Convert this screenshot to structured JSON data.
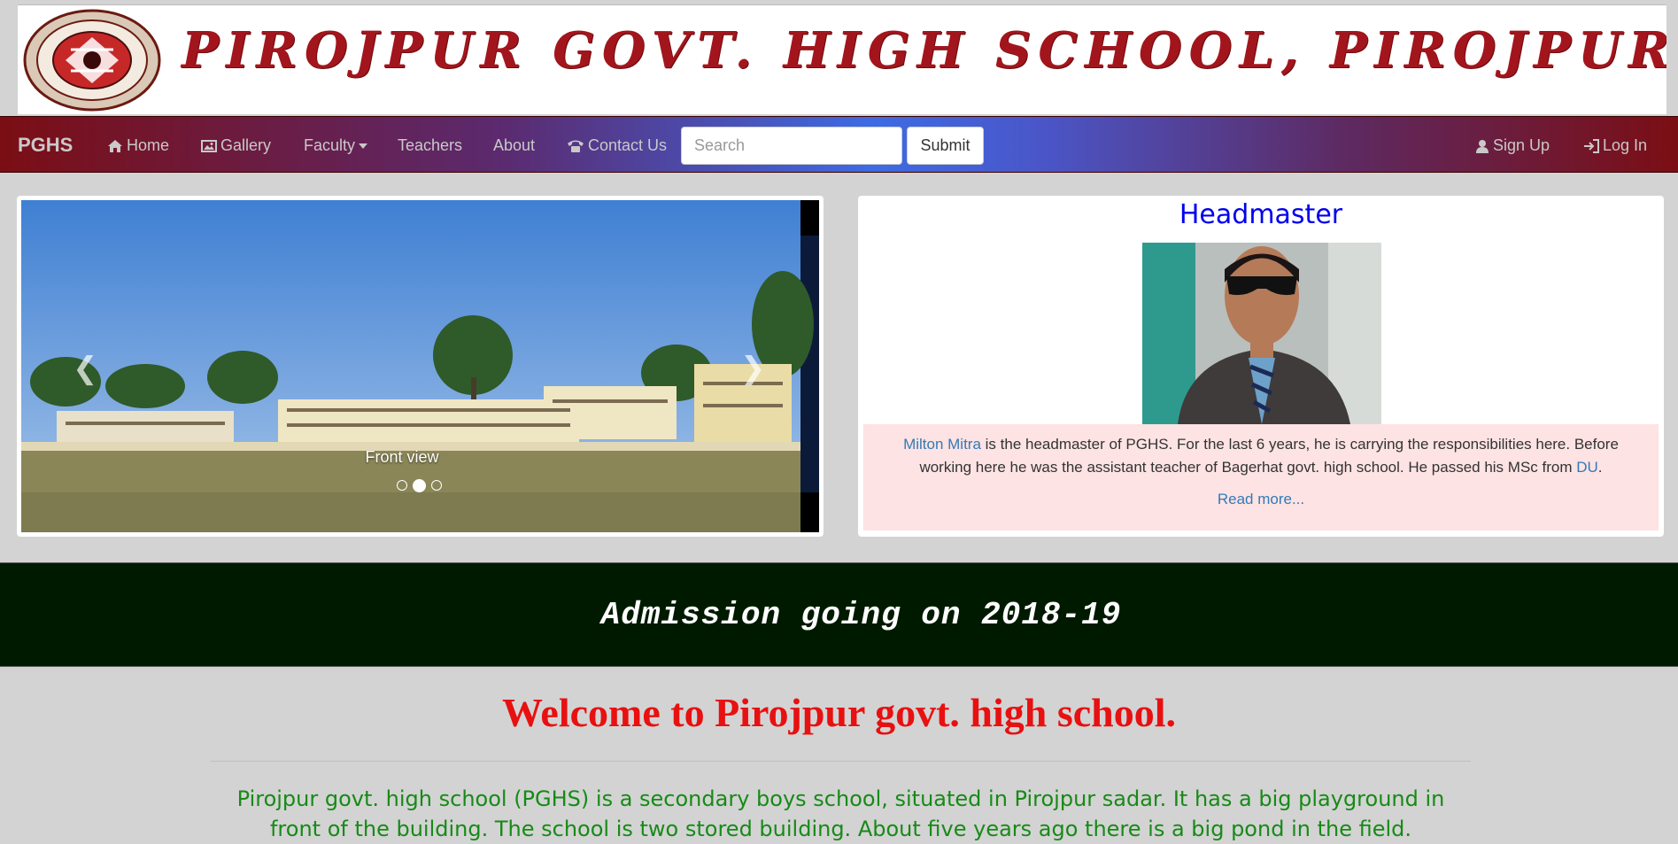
{
  "banner": {
    "title": "PIROJPUR GOVT. HIGH SCHOOL, PIROJPUR."
  },
  "navbar": {
    "brand": "PGHS",
    "items": [
      {
        "label": "Home",
        "icon": "home-icon"
      },
      {
        "label": "Gallery",
        "icon": "picture-icon"
      },
      {
        "label": "Faculty",
        "icon": "caret-down-icon"
      },
      {
        "label": "Teachers"
      },
      {
        "label": "About"
      },
      {
        "label": "Contact Us",
        "icon": "phone-icon"
      }
    ],
    "search_placeholder": "Search",
    "submit_label": "Submit",
    "signup_label": "Sign Up",
    "login_label": "Log In",
    "colors": {
      "start": "#7b0e14",
      "middle": "#3d6be4",
      "end": "#7b0e14"
    }
  },
  "carousel": {
    "caption": "Front view",
    "slide_count": 3,
    "active_index": 1,
    "prev_icon": "chevron-left-icon",
    "next_icon": "chevron-right-icon"
  },
  "headmaster": {
    "title": "Headmaster",
    "name": "Milton Mitra",
    "desc_part1": " is the headmaster of PGHS. For the last 6 years, he is carrying the responsibilities here. Before working here he was the assistant teacher of Bagerhat govt. high school. He passed his MSc from ",
    "university": "DU",
    "desc_end": ".",
    "read_more": "Read more..."
  },
  "admission": {
    "text": "Admission going on 2018-19"
  },
  "welcome": {
    "heading": "Welcome to Pirojpur govt. high school.",
    "intro": "Pirojpur govt. high school (PGHS) is a secondary boys school, situated in Pirojpur sadar. It has a big playground in front of the building. The school is two stored building. About five years ago there is a big pond in the field."
  }
}
